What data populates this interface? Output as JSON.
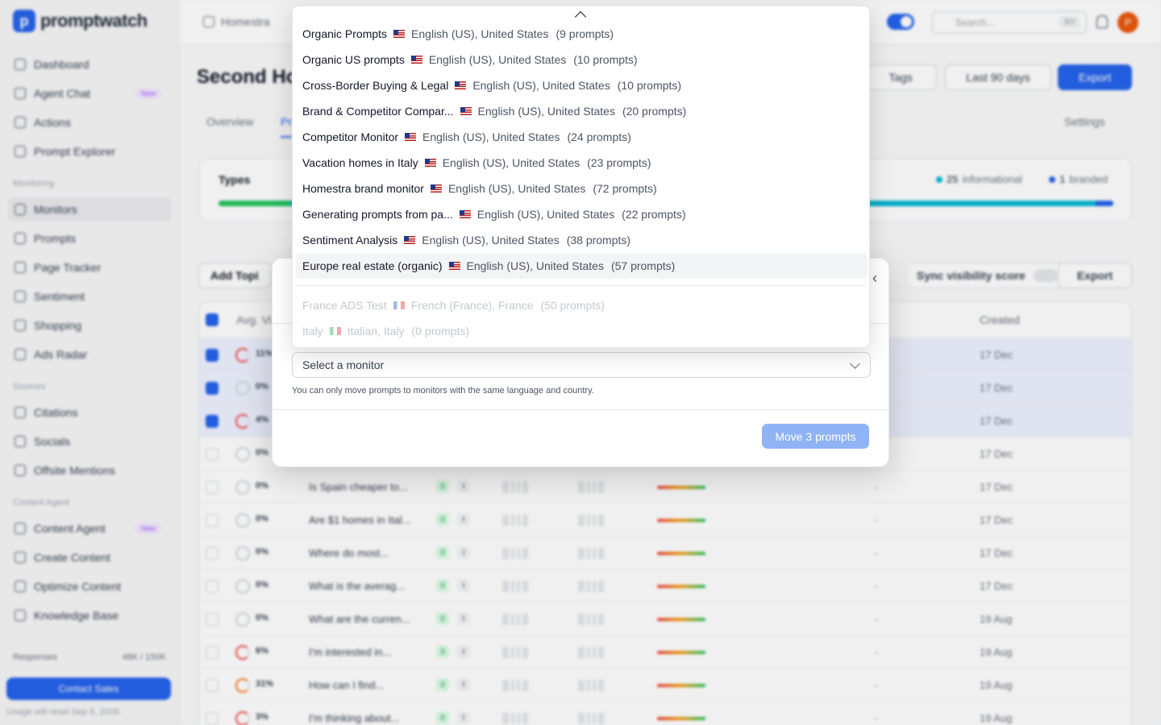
{
  "sidebar": {
    "logo_letter": "p",
    "logo_text": "promptwatch",
    "items_top": [
      {
        "label": "Dashboard"
      },
      {
        "label": "Agent Chat",
        "badge": "New"
      },
      {
        "label": "Actions"
      },
      {
        "label": "Prompt Explorer"
      }
    ],
    "section_monitoring": "Monitoring",
    "items_monitoring": [
      {
        "label": "Monitors"
      },
      {
        "label": "Prompts"
      },
      {
        "label": "Page Tracker"
      },
      {
        "label": "Sentiment"
      },
      {
        "label": "Shopping"
      },
      {
        "label": "Ads Radar"
      }
    ],
    "section_sources": "Sources",
    "items_sources": [
      {
        "label": "Citations"
      },
      {
        "label": "Socials"
      },
      {
        "label": "Offsite Mentions"
      }
    ],
    "section_content": "Content Agent",
    "items_content": [
      {
        "label": "Content Agent",
        "badge": "New"
      },
      {
        "label": "Create Content"
      },
      {
        "label": "Optimize Content"
      },
      {
        "label": "Knowledge Base"
      }
    ],
    "responses_label": "Responses",
    "responses_value": "48K / 150K",
    "contact_label": "Contact Sales",
    "usage_text": "Usage will reset Sep 8, 2026"
  },
  "topbar": {
    "breadcrumb": "Homestra",
    "search_placeholder": "Search...",
    "search_kbd": "⌘K",
    "avatar_letter": "P"
  },
  "page": {
    "title": "Second Ho",
    "tags_label": "Tags",
    "date_label": "Last 90 days",
    "export_label": "Export",
    "tabs": [
      "Overview",
      "Pr"
    ],
    "settings_label": "Settings",
    "types_label": "Types",
    "informational_count": "25",
    "informational_label": "informational",
    "branded_count": "1",
    "branded_label": "branded",
    "add_topic_label": "Add Topi",
    "sync_label": "Sync visibility score",
    "export2_label": "Export",
    "col_avg": "Avg. Vi",
    "col_created": "Created"
  },
  "table_rows": [
    {
      "vis": "11%",
      "text": "",
      "date": "17 Dec",
      "checked": true
    },
    {
      "vis": "0%",
      "text": "",
      "date": "17 Dec",
      "checked": true
    },
    {
      "vis": "4%",
      "text": "",
      "date": "17 Dec",
      "checked": true
    },
    {
      "vis": "0%",
      "text": "",
      "date": "17 Dec",
      "checked": false
    },
    {
      "vis": "0%",
      "text": "Is Spain cheaper to...",
      "date": "17 Dec",
      "checked": false
    },
    {
      "vis": "0%",
      "text": "Are $1 homes in Ital...",
      "date": "17 Dec",
      "checked": false
    },
    {
      "vis": "0%",
      "text": "Where do most...",
      "date": "17 Dec",
      "checked": false
    },
    {
      "vis": "0%",
      "text": "What is the averag...",
      "date": "17 Dec",
      "checked": false
    },
    {
      "vis": "0%",
      "text": "What are the curren...",
      "date": "19 Aug",
      "checked": false
    },
    {
      "vis": "6%",
      "text": "I'm interested in...",
      "date": "19 Aug",
      "checked": false
    },
    {
      "vis": "31%",
      "text": "How can I find...",
      "date": "19 Aug",
      "checked": false
    },
    {
      "vis": "3%",
      "text": "I'm thinking about...",
      "date": "19 Aug",
      "checked": false
    }
  ],
  "modal": {
    "select_placeholder": "Select a monitor",
    "helper_text": "You can only move prompts to monitors with the same language and country.",
    "move_button": "Move 3 prompts"
  },
  "dropdown": {
    "options": [
      {
        "name": "Organic Prompts",
        "flag": "us",
        "lang": "English (US), United States",
        "count": "(9 prompts)",
        "disabled": false
      },
      {
        "name": "Organic US prompts",
        "flag": "us",
        "lang": "English (US), United States",
        "count": "(10 prompts)",
        "disabled": false
      },
      {
        "name": "Cross-Border Buying & Legal",
        "flag": "us",
        "lang": "English (US), United States",
        "count": "(10 prompts)",
        "disabled": false
      },
      {
        "name": "Brand & Competitor Compar...",
        "flag": "us",
        "lang": "English (US), United States",
        "count": "(20 prompts)",
        "disabled": false
      },
      {
        "name": "Competitor Monitor",
        "flag": "us",
        "lang": "English (US), United States",
        "count": "(24 prompts)",
        "disabled": false
      },
      {
        "name": "Vacation homes in Italy",
        "flag": "us",
        "lang": "English (US), United States",
        "count": "(23 prompts)",
        "disabled": false
      },
      {
        "name": "Homestra brand monitor",
        "flag": "us",
        "lang": "English (US), United States",
        "count": "(72 prompts)",
        "disabled": false
      },
      {
        "name": "Generating prompts from pa...",
        "flag": "us",
        "lang": "English (US), United States",
        "count": "(22 prompts)",
        "disabled": false
      },
      {
        "name": "Sentiment Analysis",
        "flag": "us",
        "lang": "English (US), United States",
        "count": "(38 prompts)",
        "disabled": false
      },
      {
        "name": "Europe real estate (organic)",
        "flag": "us",
        "lang": "English (US), United States",
        "count": "(57 prompts)",
        "disabled": false,
        "highlighted": true
      },
      {
        "name": "France ADS Test",
        "flag": "fr",
        "lang": "French (France), France",
        "count": "(50 prompts)",
        "disabled": true
      },
      {
        "name": "Italy",
        "flag": "it",
        "lang": "Italian, Italy",
        "count": "(0 prompts)",
        "disabled": true
      }
    ]
  },
  "colors": {
    "accent": "#2563eb",
    "move_button_disabled": "#8fb3f5",
    "badge_new": "#a855f7"
  }
}
